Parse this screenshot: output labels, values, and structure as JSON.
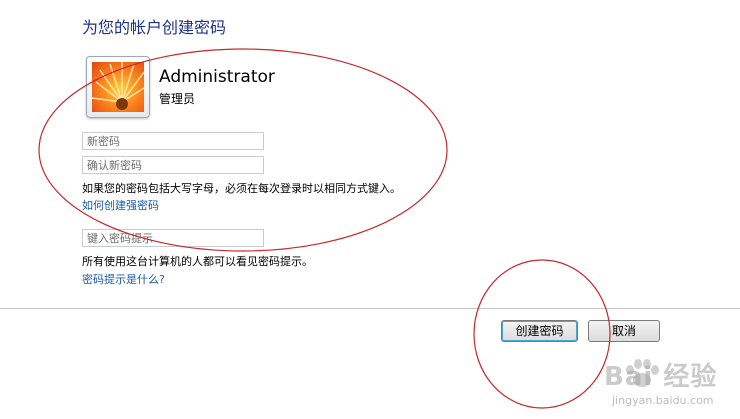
{
  "header": {
    "title": "为您的帐户创建密码"
  },
  "user": {
    "name": "Administrator",
    "role": "管理员"
  },
  "form": {
    "new_password_placeholder": "新密码",
    "confirm_password_placeholder": "确认新密码",
    "caps_note": "如果您的密码包括大写字母，必须在每次登录时以相同方式键入。",
    "strong_password_link": "如何创建强密码",
    "hint_placeholder": "键入密码提示",
    "hint_note": "所有使用这台计算机的人都可以看见密码提示。",
    "hint_help_link": "密码提示是什么?"
  },
  "buttons": {
    "create_label": "创建密码",
    "cancel_label": "取消"
  },
  "watermark": {
    "brand": "Bai 经验",
    "sub": "jingyan.baidu.com"
  },
  "colors": {
    "title": "#1e3287",
    "link": "#1a5aa6",
    "annotation": "#c8282d"
  },
  "icons": {
    "avatar": "flower-avatar-icon",
    "watermark": "paw-icon"
  }
}
